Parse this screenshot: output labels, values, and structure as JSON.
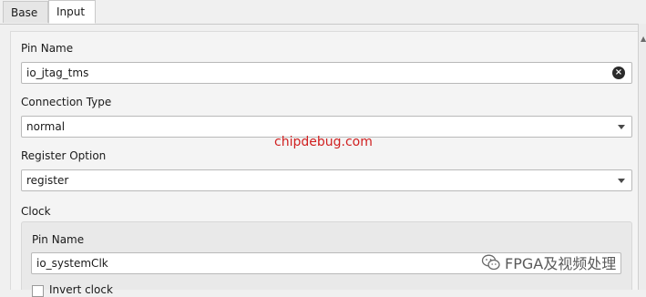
{
  "tabs": [
    {
      "label": "Base",
      "selected": false
    },
    {
      "label": "Input",
      "selected": true
    }
  ],
  "form": {
    "pin_name_label": "Pin Name",
    "pin_name_value": "io_jtag_tms",
    "connection_type_label": "Connection Type",
    "connection_type_value": "normal",
    "register_option_label": "Register Option",
    "register_option_value": "register",
    "clock": {
      "group_label": "Clock",
      "pin_name_label": "Pin Name",
      "pin_name_value": "io_systemClk",
      "checkbox_label": "Invert clock"
    }
  },
  "watermark": {
    "site": "chipdebug.com",
    "account": "FPGA及视频处理",
    "account_icon": "wechat-icon"
  },
  "colors": {
    "watermark_red": "#d01f1f",
    "panel_bg": "#f4f4f4",
    "field_bg": "#ffffff"
  }
}
